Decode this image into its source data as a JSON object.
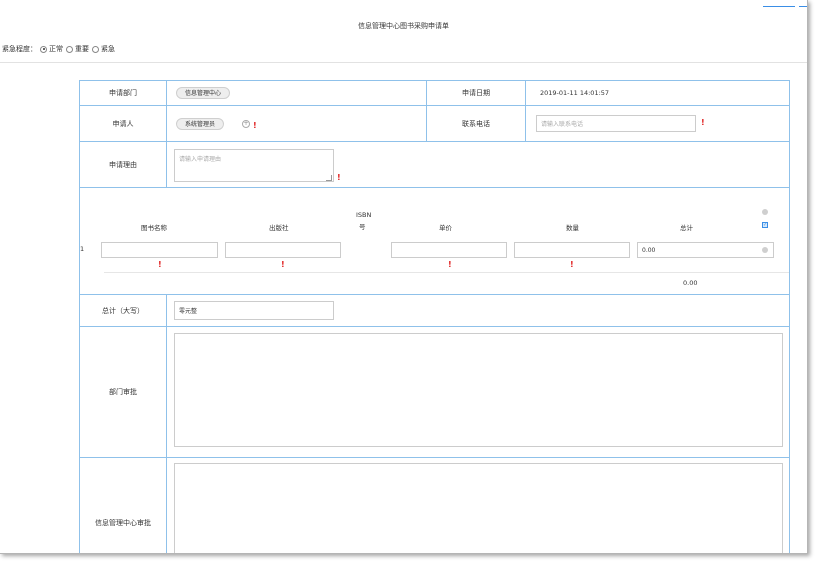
{
  "title": "信息管理中心图书采购申请单",
  "urgency": {
    "label": "紧急程度：",
    "options": [
      "正常",
      "重要",
      "紧急"
    ],
    "selected": "正常"
  },
  "form": {
    "dept_label": "申请部门",
    "dept_value": "信息管理中心",
    "date_label": "申请日期",
    "date_value": "2019-01-11 14:01:57",
    "applicant_label": "申请人",
    "applicant_value": "系统管理员",
    "phone_label": "联系电话",
    "phone_placeholder": "请输入联系电话",
    "reason_label": "申请理由",
    "reason_placeholder": "请输入申请理由",
    "table": {
      "headers": [
        "图书名称",
        "出版社",
        "ISBN号",
        "单价",
        "数量",
        "总计"
      ],
      "isbn_line1": "ISBN",
      "isbn_line2": "号",
      "row_index": "1",
      "row_total": "0.00",
      "sum_total": "0.00"
    },
    "total_caps_label": "总计（大写）",
    "total_caps_value": "零元整",
    "dept_approval_label": "部门审批",
    "center_approval_label": "信息管理中心审批"
  },
  "required_mark": "!"
}
